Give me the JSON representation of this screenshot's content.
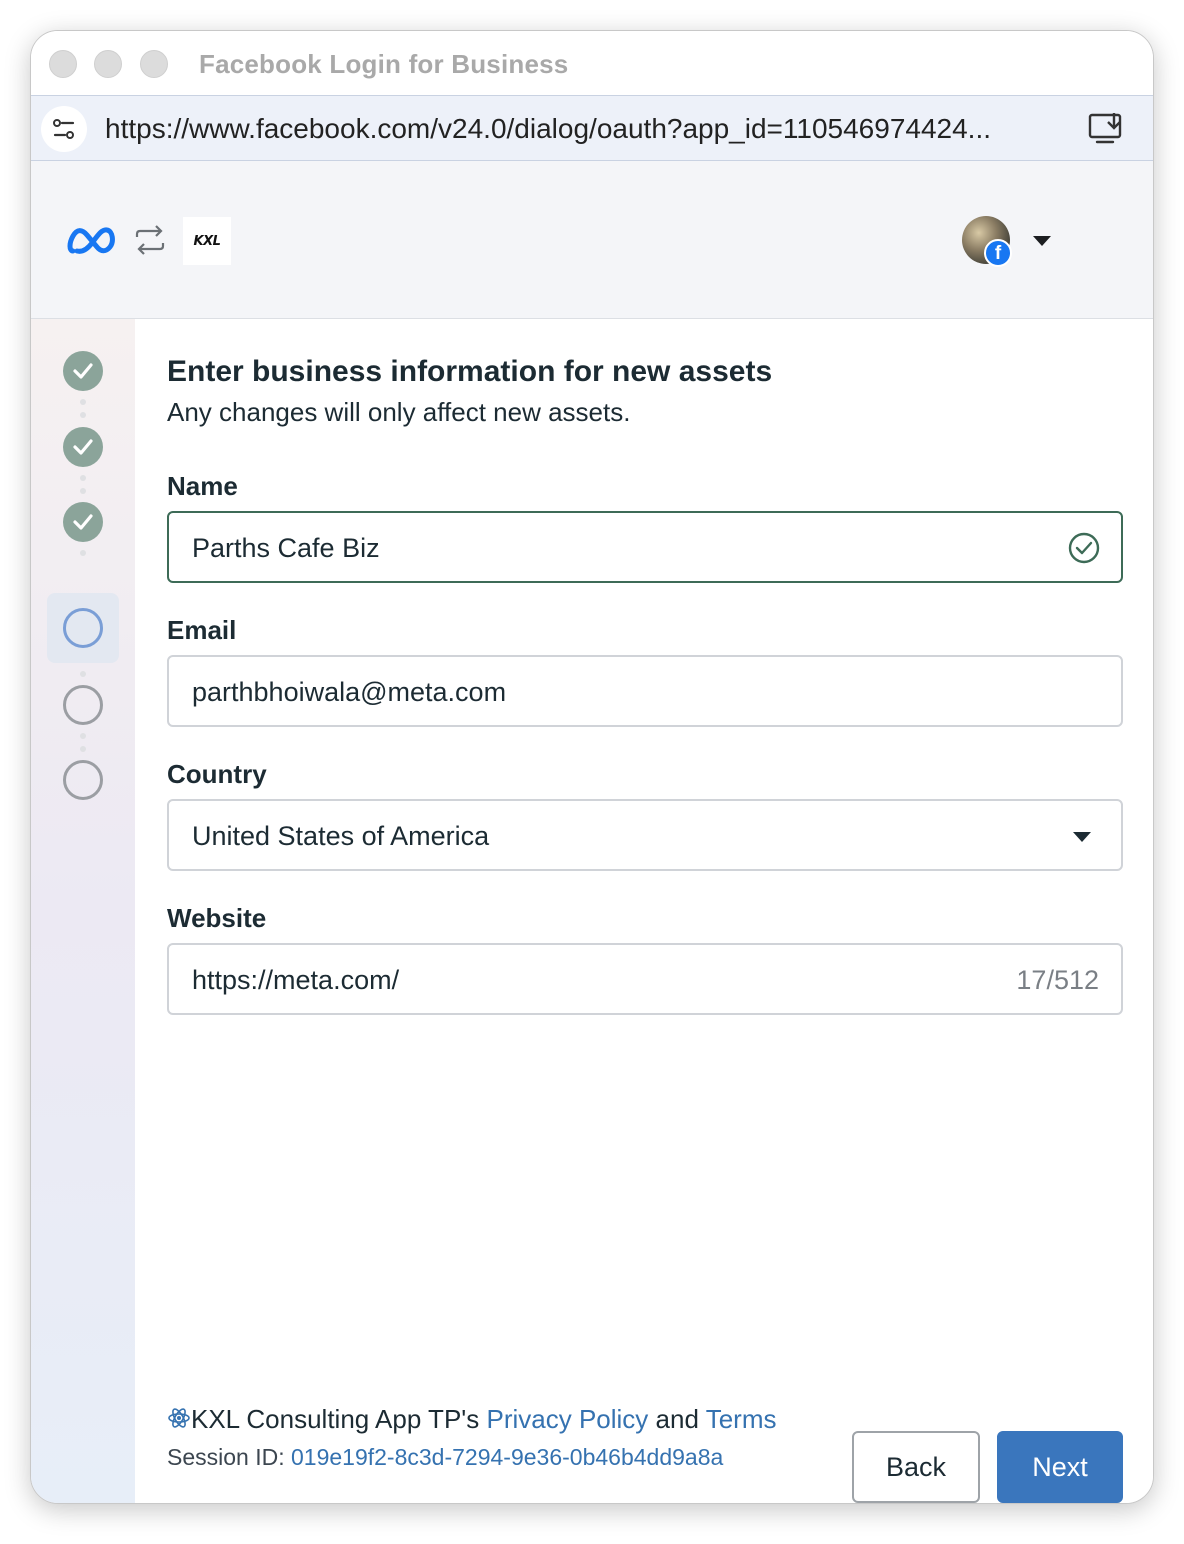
{
  "window": {
    "title": "Facebook Login for Business"
  },
  "browser": {
    "url": "https://www.facebook.com/v24.0/dialog/oauth?app_id=110546974424..."
  },
  "header": {
    "partner_logo_text": "KXL",
    "avatar_badge": "f"
  },
  "steps": [
    {
      "state": "done"
    },
    {
      "state": "done"
    },
    {
      "state": "done"
    },
    {
      "state": "current"
    },
    {
      "state": "todo"
    },
    {
      "state": "todo"
    }
  ],
  "form": {
    "title": "Enter business information for new assets",
    "subtitle": "Any changes will only affect new assets.",
    "name": {
      "label": "Name",
      "value": "Parths Cafe Biz"
    },
    "email": {
      "label": "Email",
      "value": "parthbhoiwala@meta.com"
    },
    "country": {
      "label": "Country",
      "value": "United States of America"
    },
    "website": {
      "label": "Website",
      "value": "https://meta.com/",
      "counter": "17/512"
    }
  },
  "footer": {
    "app_text": "KXL Consulting App TP's",
    "privacy_link": "Privacy Policy",
    "and_text": "and",
    "terms_link": "Terms",
    "session_label": "Session ID:",
    "session_id": "019e19f2-8c3d-7294-9e36-0b46b4dd9a8a"
  },
  "buttons": {
    "back": "Back",
    "next": "Next"
  },
  "colors": {
    "accent": "#3a76bd",
    "valid_border": "#3d6b57",
    "step_done": "#8ba49a",
    "step_current": "#7a9ed6",
    "link": "#3572b0"
  }
}
